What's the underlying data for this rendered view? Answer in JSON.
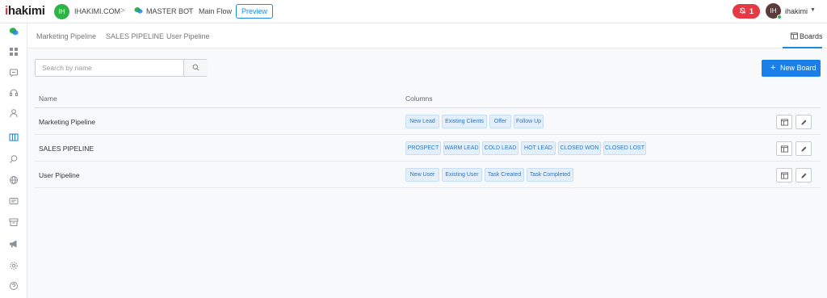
{
  "header": {
    "logo_prefix": "i",
    "logo_suffix": "hakimi",
    "workspace_avatar": "IH",
    "workspace_name": "IHAKIMI.COM",
    "bot_name": "MASTER BOT",
    "flow_name": "Main Flow",
    "preview_label": "Preview",
    "notification_count": "1",
    "user_avatar": "IH",
    "user_name": "ihakimi",
    "separator": ">"
  },
  "sidebar": {
    "icons": [
      "chat-bubbles-icon",
      "dashboard-icon",
      "inbox-icon",
      "support-headset-icon",
      "contact-icon",
      "boards-icon",
      "search-chat-icon",
      "globe-icon",
      "ticket-icon",
      "archive-icon",
      "megaphone-icon",
      "settings-icon",
      "help-icon"
    ],
    "active_icon": "boards-icon"
  },
  "subnav": {
    "tabs": [
      "Marketing Pipeline",
      "SALES PIPELINE",
      "User Pipeline"
    ],
    "boards_label": "Boards"
  },
  "search": {
    "placeholder": "Search by name",
    "value": ""
  },
  "new_board_label": "New Board",
  "table": {
    "headers": [
      "Name",
      "Columns"
    ],
    "rows": [
      {
        "name": "Marketing Pipeline",
        "columns": [
          "New Lead",
          "Existing Clients",
          "Offer",
          "Follow Up"
        ]
      },
      {
        "name": "SALES PIPELINE",
        "columns": [
          "PROSPECT",
          "WARM LEAD",
          "COLD LEAD",
          "HOT LEAD",
          "CLOSED WON",
          "CLOSED LOST"
        ]
      },
      {
        "name": "User Pipeline",
        "columns": [
          "New User",
          "Existing User",
          "Task Created",
          "Task Completed"
        ]
      }
    ]
  },
  "colors": {
    "accent": "#1a7fe8",
    "notification": "#e53945",
    "online": "#2fb344",
    "tag_bg": "#e3f0fc",
    "tag_text": "#2b74c8"
  }
}
